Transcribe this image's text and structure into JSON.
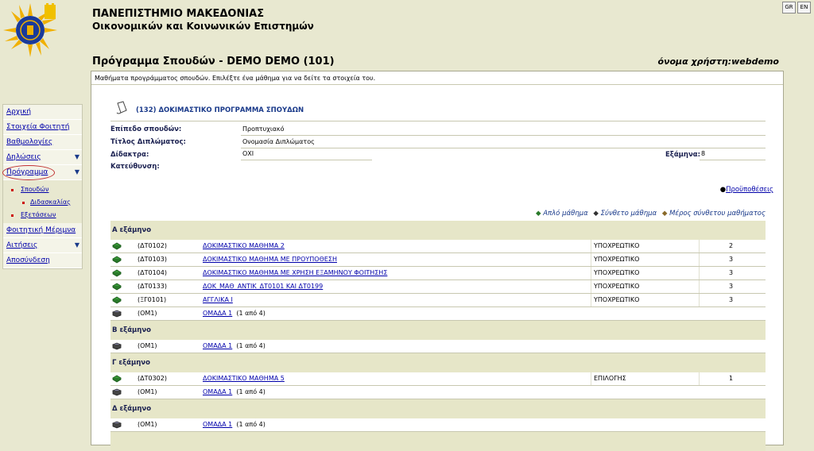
{
  "header": {
    "university_line1": "ΠΑΝΕΠΙΣΤΗΜΙΟ ΜΑΚΕΔΟΝΙΑΣ",
    "university_line2": "Οικονομικών και Κοινωνικών Επιστημών",
    "lang_gr": "GR",
    "lang_en": "EN",
    "page_title": "Πρόγραμμα Σπουδών - DEMO DEMO (101)",
    "username": "όνομα χρήστη:webdemo"
  },
  "sidebar": {
    "items": [
      {
        "label": "Αρχική"
      },
      {
        "label": "Στοιχεία Φοιτητή"
      },
      {
        "label": "Βαθμολογίες"
      },
      {
        "label": "Δηλώσεις"
      },
      {
        "label": "Πρόγραμμα"
      },
      {
        "label": "Φοιτητική Μέριμνα"
      },
      {
        "label": "Αιτήσεις"
      },
      {
        "label": "Αποσύνδεση"
      }
    ],
    "subitems": [
      {
        "label": "Σπουδών"
      },
      {
        "label": "Διδασκαλίας"
      },
      {
        "label": "Εξετάσεων"
      }
    ]
  },
  "main": {
    "instructions": "Μαθήματα προγράμματος σπουδών. Επιλέξτε ένα μάθημα για να δείτε τα στοιχεία του.",
    "program_title": "(132)  ΔΟΚΙΜΑΣΤΙΚΟ ΠΡΟΓΡΑΜΜΑ ΣΠΟΥΔΩΝ",
    "fields": {
      "level_label": "Επίπεδο σπουδών:",
      "level_value": "Προπτυχιακό",
      "degree_label": "Τίτλος Διπλώματος:",
      "degree_value": "Ονομασία Διπλώματος",
      "fees_label": "Δίδακτρα:",
      "fees_value": "ΟΧΙ",
      "semesters_label": "Εξάμηνα:",
      "semesters_value": "8",
      "direction_label": "Κατεύθυνση:"
    },
    "prerequisites_link": "Προϋποθέσεις",
    "legend": {
      "simple": "Απλό μάθημα",
      "composite": "Σύνθετο μάθημα",
      "part": "Μέρος σύνθετου μαθήματος"
    },
    "semesters": [
      {
        "label": "Α εξάμηνο",
        "courses": [
          {
            "code": "(ΔΤ0102)",
            "name": "ΔΟΚΙΜΑΣΤΙΚΟ ΜΑΘΗΜΑ 2",
            "type": "ΥΠΟΧΡΕΩΤΙΚΟ",
            "ects": "2",
            "kind": "simple"
          },
          {
            "code": "(ΔΤ0103)",
            "name": "ΔΟΚΙΜΑΣΤΙΚΟ ΜΑΘΗΜΑ ΜΕ ΠΡΟΥΠΟΘΕΣΗ",
            "type": "ΥΠΟΧΡΕΩΤΙΚΟ",
            "ects": "3",
            "kind": "simple"
          },
          {
            "code": "(ΔΤ0104)",
            "name": "ΔΟΚΙΜΑΣΤΙΚΟ ΜΑΘΗΜΑ ΜΕ ΧΡΗΣΗ ΕΞΑΜΗΝΟΥ ΦΟΙΤΗΣΗΣ",
            "type": "ΥΠΟΧΡΕΩΤΙΚΟ",
            "ects": "3",
            "kind": "simple"
          },
          {
            "code": "(ΔΤ0133)",
            "name": "ΔΟΚ_ΜΑΘ_ΑΝΤΙΚ_ΔΤ0101 ΚΑΙ ΔΤ0199",
            "type": "ΥΠΟΧΡΕΩΤΙΚΟ",
            "ects": "3",
            "kind": "simple"
          },
          {
            "code": "(ΞΓ0101)",
            "name": "ΑΓΓΛΙΚΑ Ι",
            "type": "ΥΠΟΧΡΕΩΤΙΚΟ",
            "ects": "3",
            "kind": "simple"
          },
          {
            "code": "(ΟΜ1)",
            "name": "ΟΜΑΔΑ 1",
            "extra": "(1 από 4)",
            "type": "",
            "ects": "",
            "kind": "composite"
          }
        ]
      },
      {
        "label": "Β εξάμηνο",
        "courses": [
          {
            "code": "(ΟΜ1)",
            "name": "ΟΜΑΔΑ 1",
            "extra": "(1 από 4)",
            "type": "",
            "ects": "",
            "kind": "composite"
          }
        ]
      },
      {
        "label": "Γ εξάμηνο",
        "courses": [
          {
            "code": "(ΔΤ0302)",
            "name": "ΔΟΚΙΜΑΣΤΙΚΟ ΜΑΘΗΜΑ 5",
            "type": "ΕΠΙΛΟΓΗΣ",
            "ects": "1",
            "kind": "simple"
          },
          {
            "code": "(ΟΜ1)",
            "name": "ΟΜΑΔΑ 1",
            "extra": "(1 από 4)",
            "type": "",
            "ects": "",
            "kind": "composite"
          }
        ]
      },
      {
        "label": "Δ εξάμηνο",
        "courses": [
          {
            "code": "(ΟΜ1)",
            "name": "ΟΜΑΔΑ 1",
            "extra": "(1 από 4)",
            "type": "",
            "ects": "",
            "kind": "composite"
          }
        ]
      }
    ]
  },
  "colors": {
    "background": "#e8e8d0",
    "semester_band": "#e6e6c8",
    "link": "#0000aa",
    "accent_red": "#c03030"
  }
}
